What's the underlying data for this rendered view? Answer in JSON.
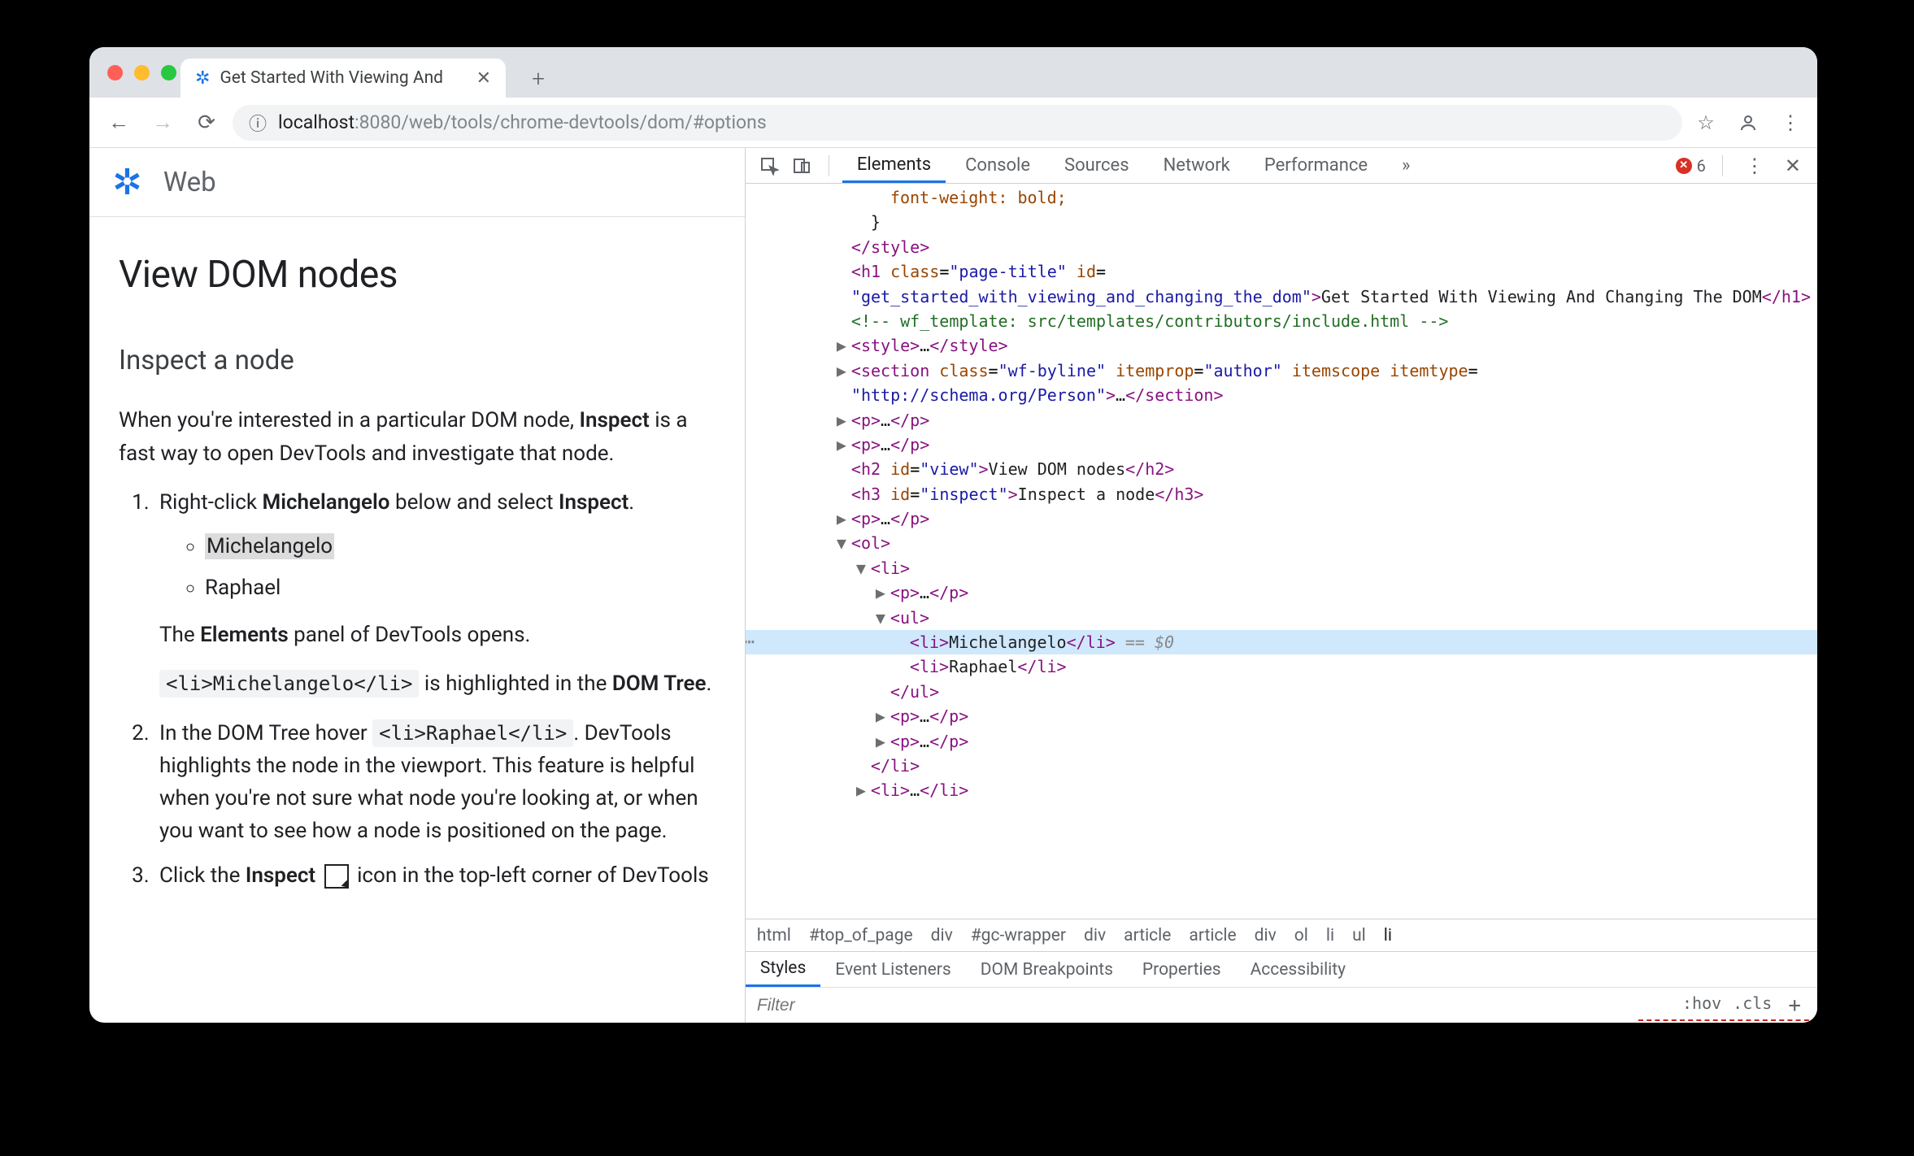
{
  "browser": {
    "tab_title": "Get Started With Viewing And",
    "url_host": "localhost",
    "url_port": ":8080",
    "url_path": "/web/tools/chrome-devtools/dom/#options"
  },
  "page": {
    "site_name": "Web",
    "h1": "View DOM nodes",
    "h2": "Inspect a node",
    "intro_a": "When you're interested in a particular DOM node, ",
    "intro_b": "Inspect",
    "intro_c": " is a fast way to open DevTools and investigate that node.",
    "step1_a": "Right-click ",
    "step1_b": "Michelangelo",
    "step1_c": " below and select ",
    "step1_d": "Inspect",
    "step1_e": ".",
    "bullet1": "Michelangelo",
    "bullet2": "Raphael",
    "step1_post_a": "The ",
    "step1_post_b": "Elements",
    "step1_post_c": " panel of DevTools opens.",
    "step1_code": "<li>Michelangelo</li>",
    "step1_code_post_a": " is highlighted in the ",
    "step1_code_post_b": "DOM Tree",
    "step1_code_post_c": ".",
    "step2_a": "In the DOM Tree hover ",
    "step2_code": "<li>Raphael</li>",
    "step2_b": ". DevTools highlights the node in the viewport. This feature is helpful when you're not sure what node you're looking at, or when you want to see how a node is positioned on the page.",
    "step3_a": "Click the ",
    "step3_b": "Inspect",
    "step3_c": " icon in the top-left corner of DevTools"
  },
  "devtools": {
    "tabs": [
      "Elements",
      "Console",
      "Sources",
      "Network",
      "Performance"
    ],
    "more": "»",
    "error_count": "6",
    "styles_tabs": [
      "Styles",
      "Event Listeners",
      "DOM Breakpoints",
      "Properties",
      "Accessibility"
    ],
    "filter_placeholder": "Filter",
    "hov": ":hov",
    "cls": ".cls",
    "breadcrumbs": [
      "html",
      "#top_of_page",
      "div",
      "#gc-wrapper",
      "div",
      "article",
      "article",
      "div",
      "ol",
      "li",
      "ul",
      "li"
    ],
    "dom": {
      "css_frag": "font-weight: bold;",
      "close_brace": "}",
      "h1_class": "page-title",
      "h1_id": "get_started_with_viewing_and_changing_the_dom",
      "h1_text": "Get Started With Viewing And Changing The DOM",
      "comment": " wf_template: src/templates/contributors/include.html ",
      "section_class": "wf-byline",
      "section_itemprop": "author",
      "section_itemtype": "http://schema.org/Person",
      "h2_id": "view",
      "h2_text": "View DOM nodes",
      "h3_id": "inspect",
      "h3_text": "Inspect a node",
      "li1": "Michelangelo",
      "li2": "Raphael",
      "eq0": "== $0"
    }
  }
}
